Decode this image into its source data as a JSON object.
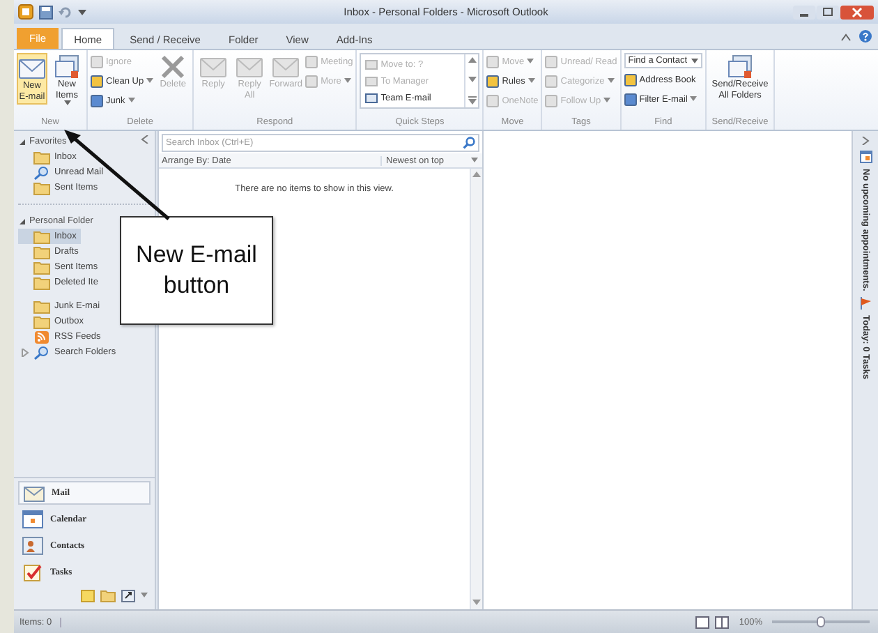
{
  "window": {
    "title": "Inbox - Personal Folders - Microsoft Outlook"
  },
  "tabs": [
    {
      "label": "File",
      "kind": "backstage",
      "selected": false
    },
    {
      "label": "Home",
      "kind": "tab",
      "selected": true
    },
    {
      "label": "Send / Receive",
      "kind": "tab",
      "selected": false
    },
    {
      "label": "Folder",
      "kind": "tab",
      "selected": false
    },
    {
      "label": "View",
      "kind": "tab",
      "selected": false
    },
    {
      "label": "Add-Ins",
      "kind": "tab",
      "selected": false
    }
  ],
  "ribbon": {
    "groups": [
      {
        "label": "New",
        "items": [
          {
            "kind": "large",
            "label": "New E-mail",
            "disabled": false,
            "dropdown": false
          },
          {
            "kind": "large",
            "label": "New Items",
            "disabled": false,
            "dropdown": true
          }
        ]
      },
      {
        "label": "Delete",
        "items": [
          {
            "kind": "column",
            "entries": [
              {
                "label": "Ignore",
                "disabled": true,
                "dropdown": false
              },
              {
                "label": "Clean Up",
                "disabled": false,
                "dropdown": true
              },
              {
                "label": "Junk",
                "disabled": false,
                "dropdown": true
              }
            ]
          },
          {
            "kind": "large",
            "label": "Delete",
            "disabled": true,
            "dropdown": false
          }
        ]
      },
      {
        "label": "Respond",
        "items": [
          {
            "kind": "large",
            "label": "Reply",
            "disabled": true,
            "dropdown": false
          },
          {
            "kind": "large",
            "label": "Reply All",
            "disabled": true,
            "dropdown": false
          },
          {
            "kind": "large",
            "label": "Forward",
            "disabled": true,
            "dropdown": false
          },
          {
            "kind": "column",
            "entries": [
              {
                "label": "Meeting",
                "disabled": true,
                "dropdown": false
              },
              {
                "label": "More",
                "disabled": true,
                "dropdown": true
              }
            ]
          }
        ]
      },
      {
        "label": "Quick Steps",
        "items": [
          {
            "kind": "gallery",
            "entries": [
              {
                "label": "Move to: ?",
                "disabled": true
              },
              {
                "label": "To Manager",
                "disabled": true
              },
              {
                "label": "Team E-mail",
                "disabled": false
              }
            ]
          }
        ]
      },
      {
        "label": "Move",
        "items": [
          {
            "kind": "column",
            "entries": [
              {
                "label": "Move",
                "disabled": true,
                "dropdown": true
              },
              {
                "label": "Rules",
                "disabled": false,
                "dropdown": true
              },
              {
                "label": "OneNote",
                "disabled": true,
                "dropdown": false
              }
            ]
          }
        ]
      },
      {
        "label": "Tags",
        "items": [
          {
            "kind": "column",
            "entries": [
              {
                "label": "Unread/ Read",
                "disabled": true,
                "dropdown": false
              },
              {
                "label": "Categorize",
                "disabled": true,
                "dropdown": true
              },
              {
                "label": "Follow Up",
                "disabled": true,
                "dropdown": true
              }
            ]
          }
        ]
      },
      {
        "label": "Find",
        "items": [
          {
            "kind": "column",
            "entries": [
              {
                "label": "Find a Contact",
                "disabled": false,
                "dropdown": true,
                "combo": true
              },
              {
                "label": "Address Book",
                "disabled": false,
                "dropdown": false
              },
              {
                "label": "Filter E-mail",
                "disabled": false,
                "dropdown": true
              }
            ]
          }
        ]
      },
      {
        "label": "Send/Receive",
        "items": [
          {
            "kind": "large",
            "label": "Send/Receive All Folders",
            "disabled": false,
            "dropdown": false
          }
        ]
      }
    ]
  },
  "navigation": {
    "folders": [
      {
        "label": "Favorites",
        "expanded": true,
        "children": [
          {
            "label": "Inbox",
            "kind": "folder",
            "selected": false
          },
          {
            "label": "Unread Mail",
            "kind": "search",
            "selected": false
          },
          {
            "label": "Sent Items",
            "kind": "folder",
            "selected": false
          }
        ]
      },
      {
        "label": "Personal Folder",
        "expanded": true,
        "children": [
          {
            "label": "Inbox",
            "kind": "folder",
            "selected": true
          },
          {
            "label": "Drafts",
            "kind": "folder",
            "selected": false
          },
          {
            "label": "Sent Items",
            "kind": "folder",
            "selected": false
          },
          {
            "label": "Deleted Ite",
            "kind": "folder",
            "selected": false
          },
          {
            "label": "Junk E-mai",
            "kind": "folder",
            "selected": false,
            "gap": true
          },
          {
            "label": "Outbox",
            "kind": "folder",
            "selected": false
          },
          {
            "label": "RSS Feeds",
            "kind": "feed",
            "selected": false
          },
          {
            "label": "Search Folders",
            "kind": "search",
            "selected": false,
            "expanded": false
          }
        ]
      }
    ],
    "modules": [
      {
        "label": "Mail",
        "kind": "mail",
        "selected": true
      },
      {
        "label": "Calendar",
        "kind": "calendar",
        "selected": false
      },
      {
        "label": "Contacts",
        "kind": "contacts",
        "selected": false
      },
      {
        "label": "Tasks",
        "kind": "tasks",
        "selected": false
      }
    ]
  },
  "message_list": {
    "search": {
      "placeholder": "Search Inbox (Ctrl+E)"
    },
    "arrange_by": "Arrange By: Date",
    "order": "Newest on top",
    "empty_text": "There are no items to show in this view."
  },
  "todo_bar": {
    "appointments": "No upcoming appointments.",
    "tasks": "Today: 0 Tasks"
  },
  "callout": {
    "text": "New E-mail button"
  },
  "status_bar": {
    "items": "Items: 0",
    "zoom": "100%",
    "zoom_slider": {
      "level": 0.5
    }
  }
}
